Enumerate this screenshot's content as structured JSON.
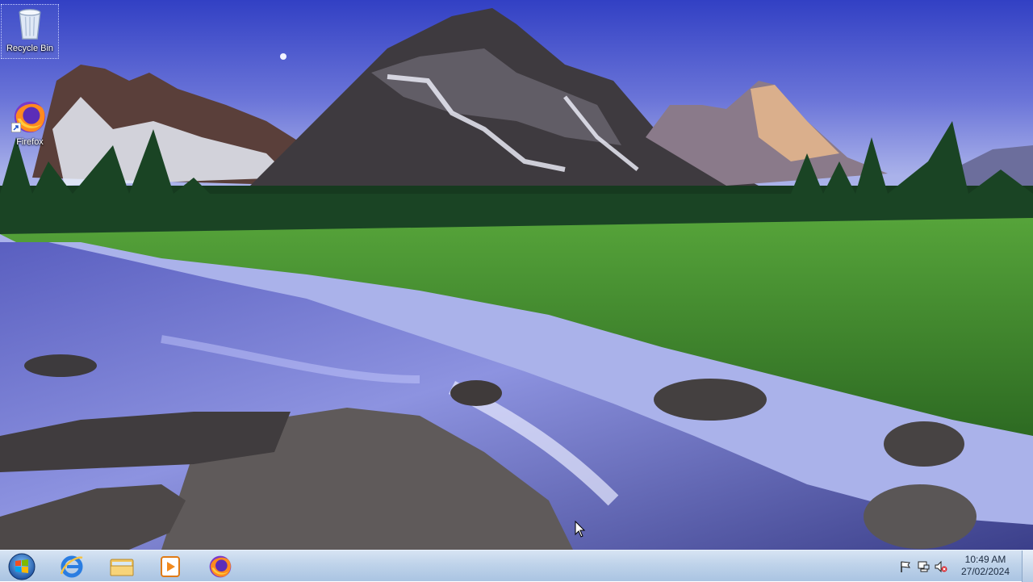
{
  "desktop": {
    "icons": [
      {
        "label": "Recycle Bin",
        "icon": "recycle-bin-icon"
      },
      {
        "label": "Firefox",
        "icon": "firefox-icon"
      }
    ]
  },
  "taskbar": {
    "pinned": [
      {
        "name": "start",
        "icon": "windows-logo-icon"
      },
      {
        "name": "internet-explorer",
        "icon": "internet-explorer-icon"
      },
      {
        "name": "file-explorer",
        "icon": "folder-icon"
      },
      {
        "name": "media-player",
        "icon": "media-player-icon"
      },
      {
        "name": "firefox",
        "icon": "firefox-icon"
      }
    ],
    "tray": {
      "icons": [
        "flag-icon",
        "network-icon",
        "volume-muted-icon"
      ],
      "time": "10:49 AM",
      "date": "27/02/2024"
    }
  }
}
